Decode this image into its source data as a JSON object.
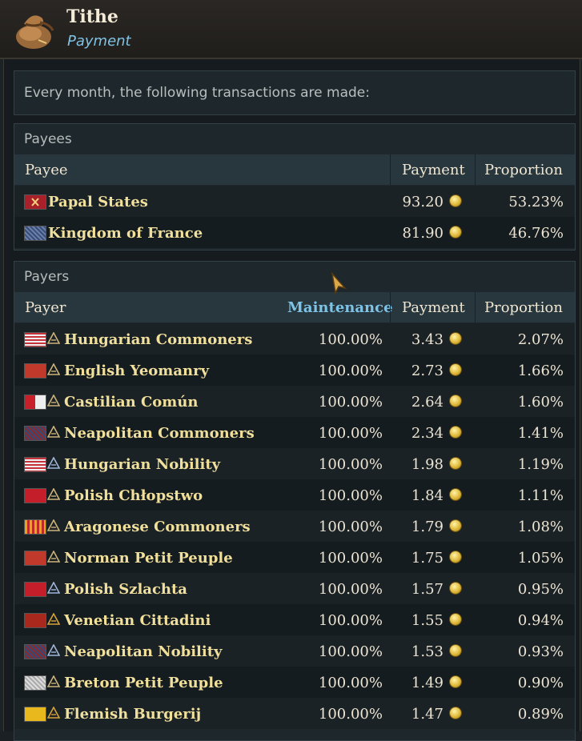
{
  "window": {
    "title": "Tithe",
    "subtitle": "Payment",
    "icon": "money-bag-icon"
  },
  "intro": "Every month, the following transactions are made:",
  "payees": {
    "section_title": "Payees",
    "columns": {
      "name": "Payee",
      "payment": "Payment",
      "proportion": "Proportion"
    },
    "rows": [
      {
        "name": "Papal States",
        "payment": "93.20",
        "proportion": "53.23%",
        "flag": "papal-flag-icon"
      },
      {
        "name": "Kingdom of France",
        "payment": "81.90",
        "proportion": "46.76%",
        "flag": "france-flag-icon"
      }
    ]
  },
  "payers": {
    "section_title": "Payers",
    "columns": {
      "name": "Payer",
      "maintenance": "Maintenance",
      "payment": "Payment",
      "proportion": "Proportion"
    },
    "rows": [
      {
        "name": "Hungarian Commoners",
        "maintenance": "100.00%",
        "payment": "3.43",
        "proportion": "2.07%",
        "flag": "hungary-flag-icon",
        "estate": "commoners-icon"
      },
      {
        "name": "English Yeomanry",
        "maintenance": "100.00%",
        "payment": "2.73",
        "proportion": "1.66%",
        "flag": "england-flag-icon",
        "estate": "commoners-icon"
      },
      {
        "name": "Castilian Común",
        "maintenance": "100.00%",
        "payment": "2.64",
        "proportion": "1.60%",
        "flag": "castile-flag-icon",
        "estate": "commoners-icon"
      },
      {
        "name": "Neapolitan Commoners",
        "maintenance": "100.00%",
        "payment": "2.34",
        "proportion": "1.41%",
        "flag": "naples-flag-icon",
        "estate": "commoners-icon"
      },
      {
        "name": "Hungarian Nobility",
        "maintenance": "100.00%",
        "payment": "1.98",
        "proportion": "1.19%",
        "flag": "hungary-flag-icon",
        "estate": "nobility-icon"
      },
      {
        "name": "Polish Chłopstwo",
        "maintenance": "100.00%",
        "payment": "1.84",
        "proportion": "1.11%",
        "flag": "poland-flag-icon",
        "estate": "commoners-icon"
      },
      {
        "name": "Aragonese Commoners",
        "maintenance": "100.00%",
        "payment": "1.79",
        "proportion": "1.08%",
        "flag": "aragon-flag-icon",
        "estate": "commoners-icon"
      },
      {
        "name": "Norman Petit Peuple",
        "maintenance": "100.00%",
        "payment": "1.75",
        "proportion": "1.05%",
        "flag": "normandy-flag-icon",
        "estate": "commoners-icon"
      },
      {
        "name": "Polish Szlachta",
        "maintenance": "100.00%",
        "payment": "1.57",
        "proportion": "0.95%",
        "flag": "poland-flag-icon",
        "estate": "nobility-icon"
      },
      {
        "name": "Venetian Cittadini",
        "maintenance": "100.00%",
        "payment": "1.55",
        "proportion": "0.94%",
        "flag": "venice-flag-icon",
        "estate": "burghers-icon"
      },
      {
        "name": "Neapolitan Nobility",
        "maintenance": "100.00%",
        "payment": "1.53",
        "proportion": "0.93%",
        "flag": "naples-flag-icon",
        "estate": "nobility-icon"
      },
      {
        "name": "Breton Petit Peuple",
        "maintenance": "100.00%",
        "payment": "1.49",
        "proportion": "0.90%",
        "flag": "brittany-flag-icon",
        "estate": "commoners-icon"
      },
      {
        "name": "Flemish Burgerij",
        "maintenance": "100.00%",
        "payment": "1.47",
        "proportion": "0.89%",
        "flag": "flanders-flag-icon",
        "estate": "burghers-icon"
      }
    ]
  },
  "colors": {
    "accent_blue": "#7ec3e6",
    "name_gold": "#f1df9c",
    "header_bg": "#28373e"
  }
}
